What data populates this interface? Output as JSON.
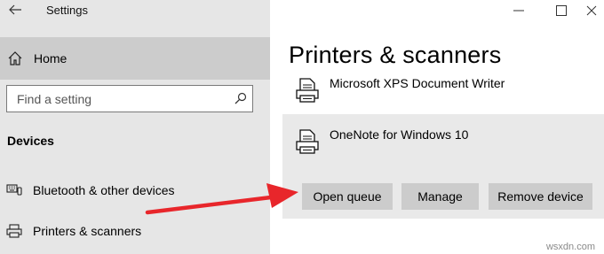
{
  "window": {
    "title": "Settings",
    "controls": {
      "minimize_icon": "minimize-icon",
      "maximize_icon": "maximize-icon",
      "close_icon": "close-icon"
    }
  },
  "sidebar": {
    "back_icon": "back-arrow-icon",
    "home_label": "Home",
    "search_placeholder": "Find a setting",
    "section_heading": "Devices",
    "items": [
      {
        "label": "Bluetooth & other devices",
        "icon": "bluetooth-devices-icon"
      },
      {
        "label": "Printers & scanners",
        "icon": "printer-icon"
      }
    ]
  },
  "main": {
    "title": "Printers & scanners",
    "printers": [
      {
        "name": "Microsoft XPS Document Writer",
        "icon": "printer-doc-icon"
      },
      {
        "name": "OneNote for Windows 10",
        "icon": "printer-doc-icon",
        "selected": true
      }
    ],
    "actions": {
      "open_queue": "Open queue",
      "manage": "Manage",
      "remove_device": "Remove device"
    }
  },
  "annotation": {
    "arrow_color": "#e8262b"
  },
  "watermark": "wsxdn.com"
}
